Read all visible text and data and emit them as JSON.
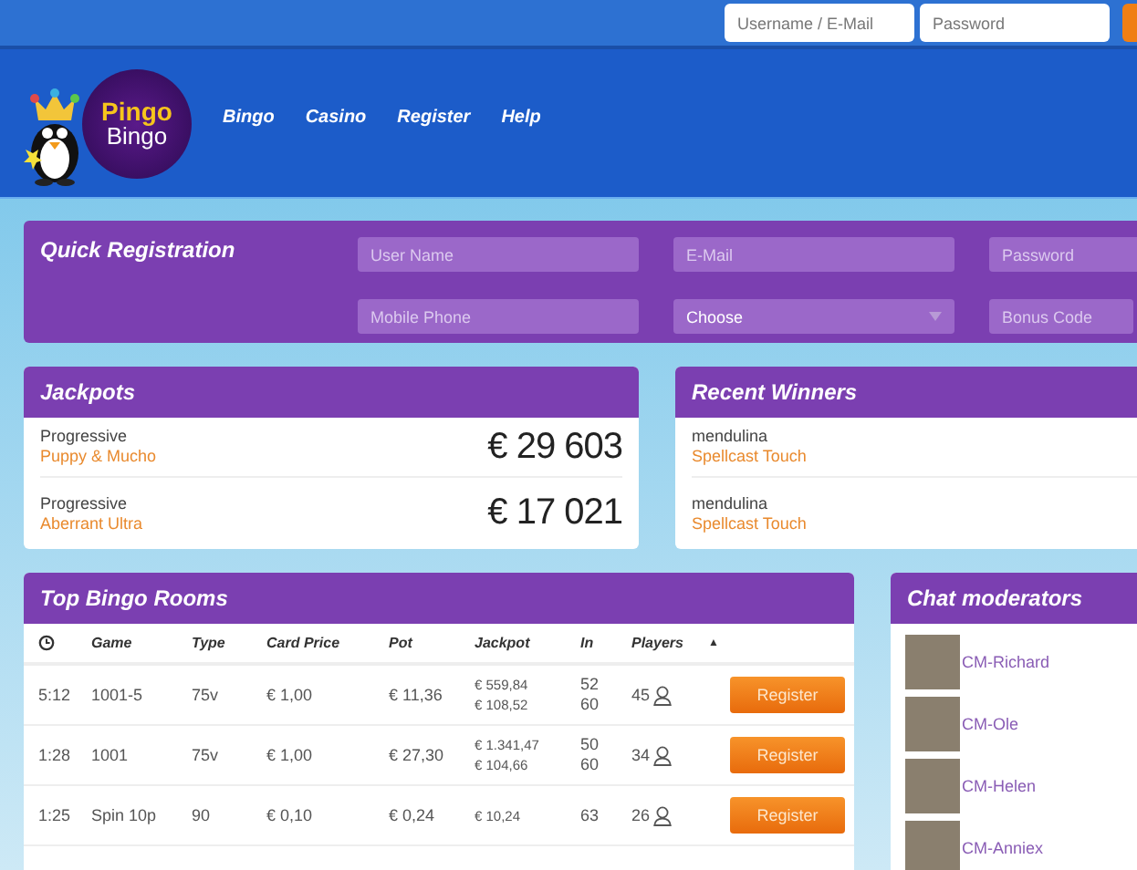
{
  "top_bar": {
    "username_placeholder": "Username / E-Mail",
    "password_placeholder": "Password"
  },
  "logo": {
    "line1": "Pingo",
    "line2": "Bingo"
  },
  "nav": [
    "Bingo",
    "Casino",
    "Register",
    "Help"
  ],
  "quick_registration": {
    "title": "Quick Registration",
    "fields": [
      {
        "kind": "input",
        "placeholder": "User Name"
      },
      {
        "kind": "input",
        "placeholder": "E-Mail"
      },
      {
        "kind": "input",
        "placeholder": "Password"
      },
      {
        "kind": "input",
        "placeholder": "Mobile Phone"
      },
      {
        "kind": "select",
        "value": "Choose"
      },
      {
        "kind": "input",
        "placeholder": "Bonus Code"
      }
    ]
  },
  "jackpots": {
    "title": "Jackpots",
    "items": [
      {
        "type": "Progressive",
        "game": "Puppy & Mucho",
        "amount": "€ 29 603"
      },
      {
        "type": "Progressive",
        "game": "Aberrant Ultra",
        "amount": "€ 17 021"
      }
    ]
  },
  "recent_winners": {
    "title": "Recent Winners",
    "items": [
      {
        "player": "mendulina",
        "game": "Spellcast Touch"
      },
      {
        "player": "mendulina",
        "game": "Spellcast Touch"
      }
    ]
  },
  "top_bingo_rooms": {
    "title": "Top Bingo Rooms",
    "columns": [
      "Game",
      "Type",
      "Card Price",
      "Pot",
      "Jackpot",
      "In",
      "Players"
    ],
    "sort_indicator": "▲",
    "rows": [
      {
        "time": "5:12",
        "game": "1001-5",
        "type": "75v",
        "card_price": "€ 1,00",
        "pot": "€ 11,36",
        "jackpot": [
          "€ 559,84",
          "€ 108,52"
        ],
        "in": [
          "52",
          "60"
        ],
        "players": "45",
        "action": "Register"
      },
      {
        "time": "1:28",
        "game": "1001",
        "type": "75v",
        "card_price": "€ 1,00",
        "pot": "€ 27,30",
        "jackpot": [
          "€ 1.341,47",
          "€ 104,66"
        ],
        "in": [
          "50",
          "60"
        ],
        "players": "34",
        "action": "Register"
      },
      {
        "time": "1:25",
        "game": "Spin 10p",
        "type": "90",
        "card_price": "€ 0,10",
        "pot": "€ 0,24",
        "jackpot": [
          "€ 10,24"
        ],
        "in": [
          "63"
        ],
        "players": "26",
        "action": "Register"
      }
    ]
  },
  "chat_moderators": {
    "title": "Chat moderators",
    "items": [
      {
        "name": "CM-Richard"
      },
      {
        "name": "CM-Ole"
      },
      {
        "name": "CM-Helen"
      },
      {
        "name": "CM-Anniex"
      }
    ]
  }
}
